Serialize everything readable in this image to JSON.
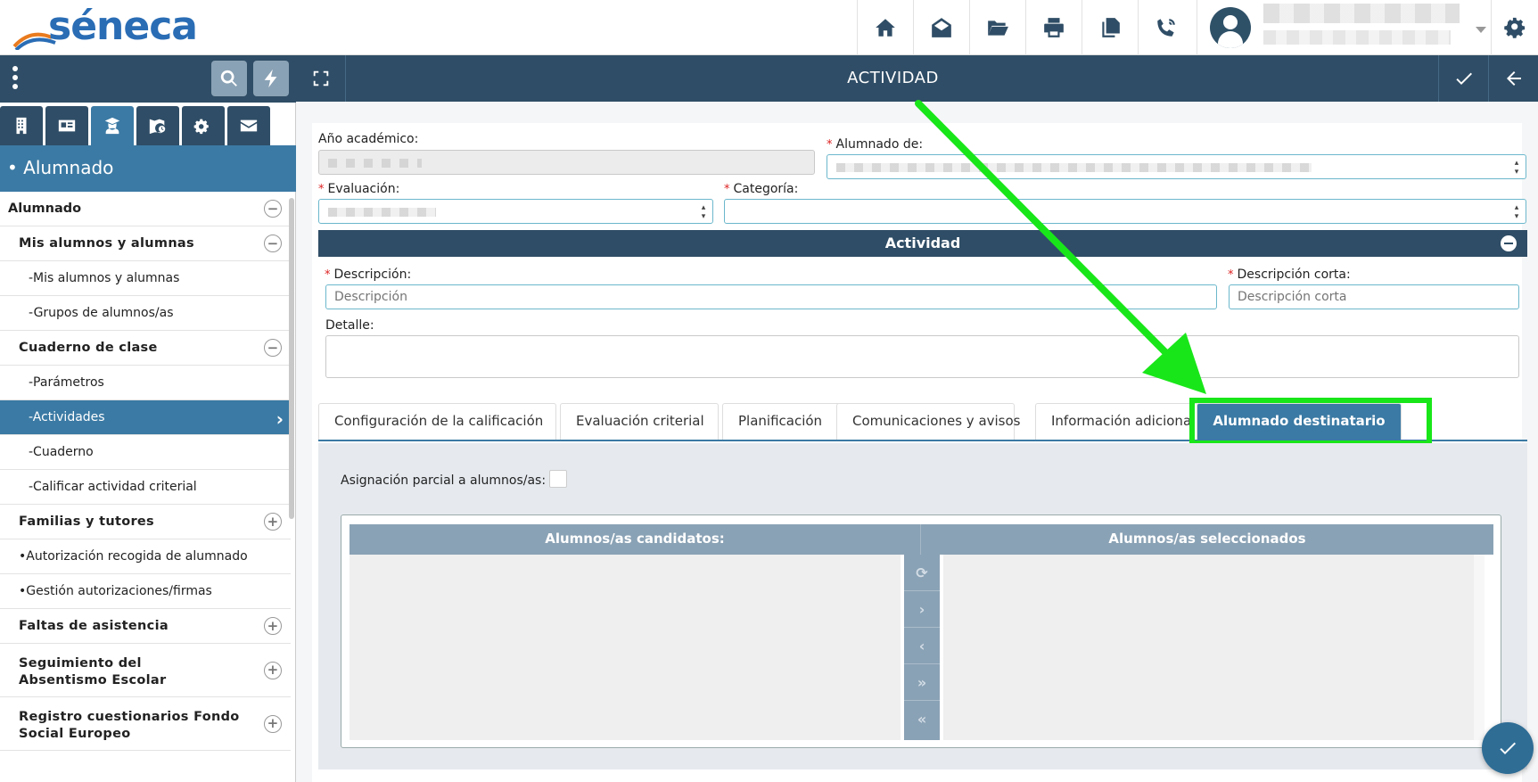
{
  "header": {
    "logo_text": "séneca",
    "icons": [
      "home-icon",
      "mail-open-icon",
      "folder-open-icon",
      "print-icon",
      "copy-icon",
      "phone-ringing-icon"
    ],
    "settings_icon": "gear-icon"
  },
  "sidebar": {
    "section_title": "• Alumnado",
    "menu": [
      {
        "label": "Alumnado",
        "level": 0,
        "toggle": "−"
      },
      {
        "label": "Mis alumnos y alumnas",
        "level": 1,
        "toggle": "−"
      },
      {
        "label": "-Mis alumnos y alumnas",
        "level": 2
      },
      {
        "label": "-Grupos de alumnos/as",
        "level": 2
      },
      {
        "label": "Cuaderno de clase",
        "level": 1,
        "toggle": "−"
      },
      {
        "label": "-Parámetros",
        "level": 2
      },
      {
        "label": "-Actividades",
        "level": 2,
        "active": true
      },
      {
        "label": "-Cuaderno",
        "level": 2
      },
      {
        "label": "-Calificar actividad criterial",
        "level": 2
      },
      {
        "label": "Familias y tutores",
        "level": 1,
        "toggle": "+"
      },
      {
        "label": "•Autorización recogida de alumnado",
        "level": 3
      },
      {
        "label": "•Gestión autorizaciones/firmas",
        "level": 3
      },
      {
        "label": "Faltas de asistencia",
        "level": 1,
        "toggle": "+"
      },
      {
        "label": "Seguimiento del Absentismo Escolar",
        "level": 1,
        "toggle": "+",
        "tall": true
      },
      {
        "label": "Registro cuestionarios Fondo Social Europeo",
        "level": 1,
        "toggle": "+",
        "tall": true
      }
    ]
  },
  "titlebar": {
    "title": "ACTIVIDAD"
  },
  "form": {
    "anio_label": "Año académico:",
    "alumnado_label": "Alumnado de:",
    "evaluacion_label": "Evaluación:",
    "categoria_label": "Categoría:",
    "section_title": "Actividad",
    "descripcion_label": "Descripción:",
    "descripcion_placeholder": "Descripción",
    "descripcion_corta_label": "Descripción corta:",
    "descripcion_corta_placeholder": "Descripción corta",
    "detalle_label": "Detalle:"
  },
  "tabs": [
    {
      "label": "Configuración de la calificación"
    },
    {
      "label": "Evaluación criterial"
    },
    {
      "label": "Planificación"
    },
    {
      "label": "Comunicaciones y avisos"
    },
    {
      "label": "Información adicional"
    },
    {
      "label": "Alumnado destinatario",
      "active": true
    }
  ],
  "panel": {
    "asignacion_label": "Asignación parcial a alumnos/as:",
    "candidatos_header": "Alumnos/as candidatos:",
    "seleccionados_header": "Alumnos/as seleccionados",
    "controls": [
      "⟳",
      "›",
      "‹",
      "»",
      "«"
    ]
  },
  "colors": {
    "primary": "#2f4d66",
    "accent": "#3b7aa4",
    "highlight": "#19e619"
  }
}
